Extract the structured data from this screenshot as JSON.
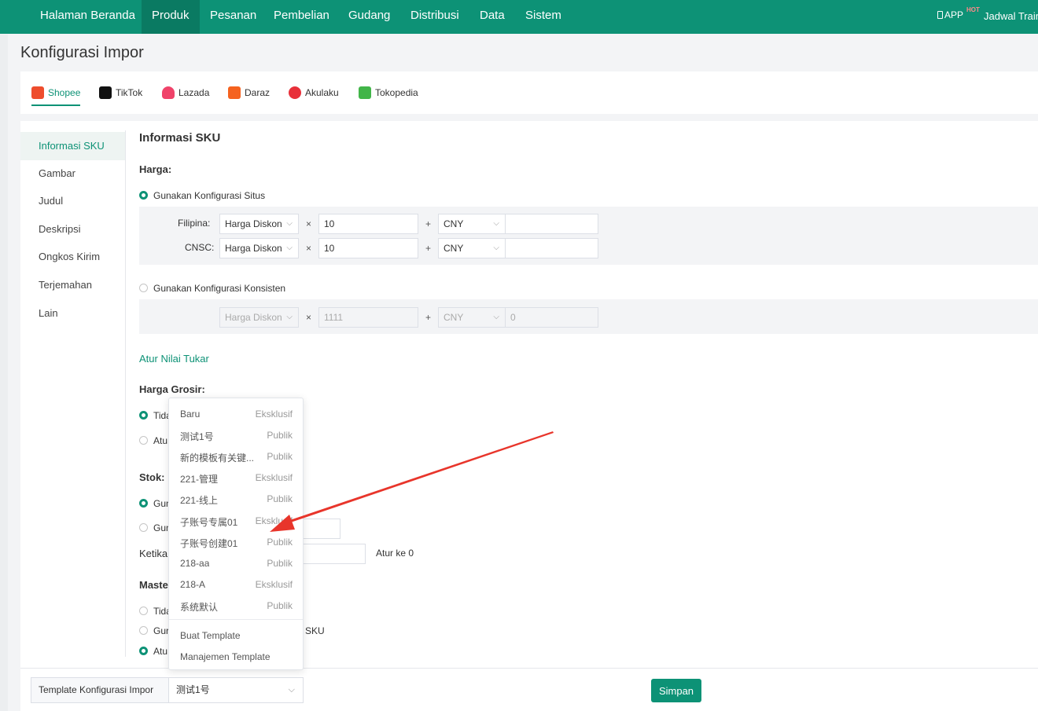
{
  "topnav": {
    "items": [
      "Halaman Beranda",
      "Produk",
      "Pesanan",
      "Pembelian",
      "Gudang",
      "Distribusi",
      "Data",
      "Sistem"
    ],
    "active_index": 1,
    "app_label": "APP",
    "hot_badge": "HOT",
    "right_text": "Jadwal Train"
  },
  "page": {
    "title": "Konfigurasi Impor"
  },
  "platforms": [
    {
      "name": "Shopee",
      "color": "#ee4d2d"
    },
    {
      "name": "TikTok",
      "color": "#111111"
    },
    {
      "name": "Lazada",
      "color": "#f0436a"
    },
    {
      "name": "Daraz",
      "color": "#f5621f"
    },
    {
      "name": "Akulaku",
      "color": "#e8303a"
    },
    {
      "name": "Tokopedia",
      "color": "#42b549"
    }
  ],
  "sidebar": {
    "items": [
      "Informasi SKU",
      "Gambar",
      "Judul",
      "Deskripsi",
      "Ongkos Kirim",
      "Terjemahan",
      "Lain"
    ],
    "active_index": 0
  },
  "section": {
    "title": "Informasi SKU",
    "harga_label": "Harga:",
    "option_site": "Gunakan Konfigurasi Situs",
    "rows": [
      {
        "label": "Filipina:",
        "price_type": "Harga Diskon",
        "multiplier": "10",
        "currency": "CNY",
        "extra": ""
      },
      {
        "label": "CNSC:",
        "price_type": "Harga Diskon",
        "multiplier": "10",
        "currency": "CNY",
        "extra": ""
      }
    ],
    "times": "×",
    "plus": "+",
    "option_consistent": "Gunakan Konfigurasi Konsisten",
    "consistent_row": {
      "price_type": "Harga Diskon",
      "multiplier": "1111",
      "currency": "CNY",
      "extra": "0"
    },
    "exchange_link": "Atur Nilai Tukar",
    "grosir_label": "Harga Grosir:",
    "grosir_opt1": "Tida",
    "grosir_opt2": "Atu",
    "stok_label": "Stok:",
    "stok_opt1": "Gun",
    "stok_opt2": "Gun",
    "ketika_label": "Ketika",
    "atur_ke_0": "Atur ke 0",
    "master_label": "Maste",
    "master_opt1": "Tida",
    "master_opt2": "Gur",
    "master_opt2_tail": "SKU",
    "master_opt3": "Atu"
  },
  "dropdown": {
    "items": [
      {
        "name": "Baru",
        "type": "Eksklusif"
      },
      {
        "name": "测试1号",
        "type": "Publik"
      },
      {
        "name": "新的模板有关键...",
        "type": "Publik"
      },
      {
        "name": "221-管理",
        "type": "Eksklusif"
      },
      {
        "name": "221-线上",
        "type": "Publik"
      },
      {
        "name": "子账号专属01",
        "type": "Eksklusif"
      },
      {
        "name": "子账号创建01",
        "type": "Publik"
      },
      {
        "name": "218-aa",
        "type": "Publik"
      },
      {
        "name": "218-A",
        "type": "Eksklusif"
      },
      {
        "name": "系统默认",
        "type": "Publik"
      }
    ],
    "create_label": "Buat Template",
    "manage_label": "Manajemen Template"
  },
  "bottom": {
    "template_label": "Template Konfigurasi Impor",
    "template_value": "测试1号",
    "save_label": "Simpan"
  },
  "colors": {
    "brand": "#0d9276",
    "arrow": "#e8352b"
  }
}
